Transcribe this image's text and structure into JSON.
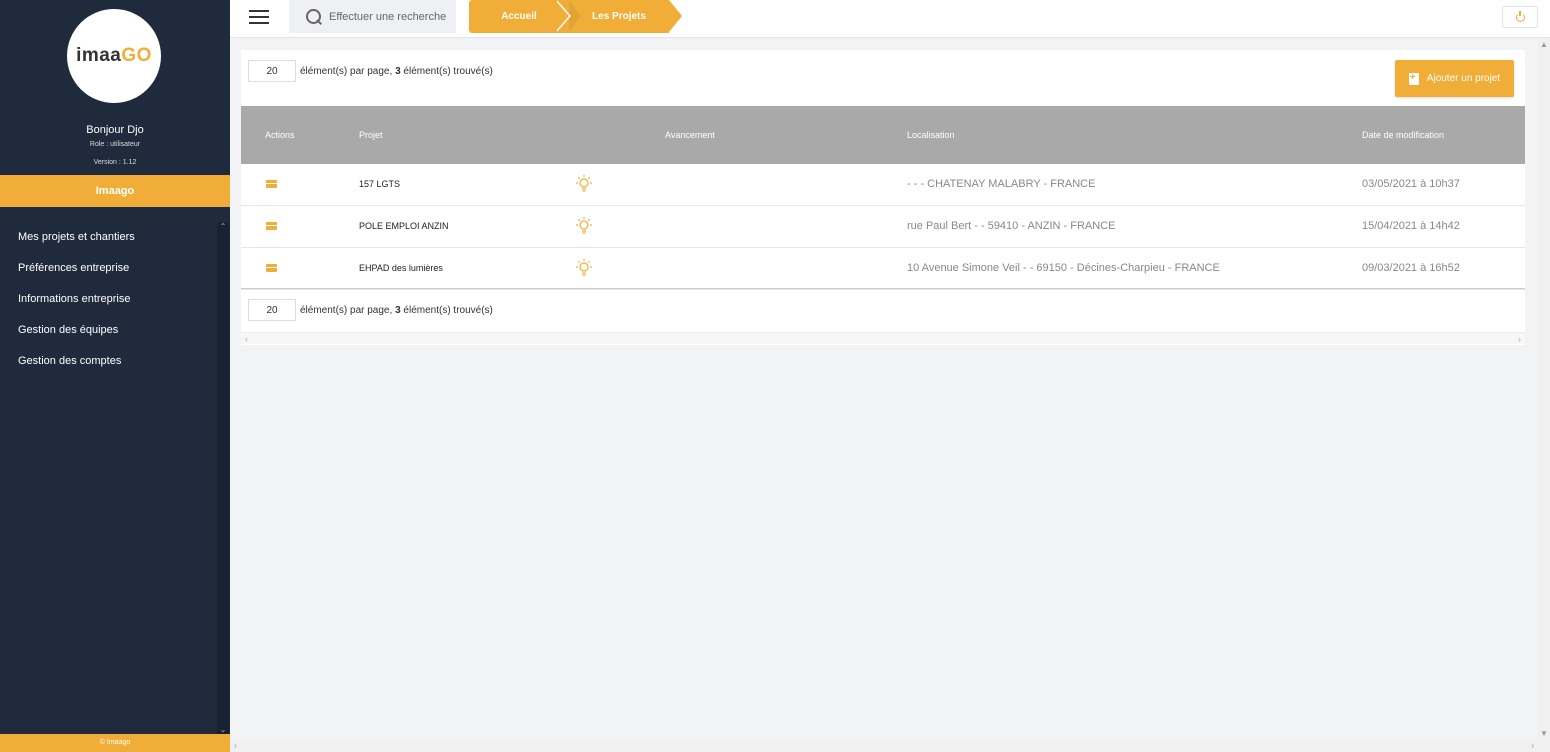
{
  "sidebar": {
    "logo": {
      "main": "imaa",
      "accent": "GO"
    },
    "greeting": "Bonjour Djo",
    "role": "Role :  utilisateur",
    "version": "Version :  1.12",
    "brand": "Imaago",
    "items": [
      {
        "label": "Mes projets et chantiers"
      },
      {
        "label": "Préférences entreprise"
      },
      {
        "label": "Informations entreprise"
      },
      {
        "label": "Gestion des équipes"
      },
      {
        "label": "Gestion des comptes"
      }
    ],
    "footer": "© Imaago"
  },
  "topbar": {
    "search_placeholder": "Effectuer une recherche",
    "breadcrumbs": [
      "Accueil",
      "Les Projets"
    ]
  },
  "pager": {
    "per_page": "20",
    "per_page_label": "élément(s) par page,",
    "found_count": "3",
    "found_label": "élément(s) trouvé(s)"
  },
  "add_project_label": "Ajouter un projet",
  "table": {
    "headers": {
      "actions": "Actions",
      "projet": "Projet",
      "avancement": "Avancement",
      "localisation": "Localisation",
      "date": "Date de modification"
    },
    "rows": [
      {
        "projet": "157 LGTS",
        "localisation": "- - - CHATENAY MALABRY - FRANCE",
        "date": "03/05/2021 à 10h37"
      },
      {
        "projet": "POLE EMPLOI ANZIN",
        "localisation": "rue Paul Bert - - 59410 - ANZIN - FRANCE",
        "date": "15/04/2021 à 14h42"
      },
      {
        "projet": "EHPAD des lumières",
        "localisation": "10 Avenue Simone Veil - - 69150 - Décines-Charpieu - FRANCE",
        "date": "09/03/2021 à 16h52"
      }
    ]
  },
  "colors": {
    "accent": "#f0ad38",
    "sidebar": "#1f2a3c",
    "table_header": "#a9a9a9"
  }
}
